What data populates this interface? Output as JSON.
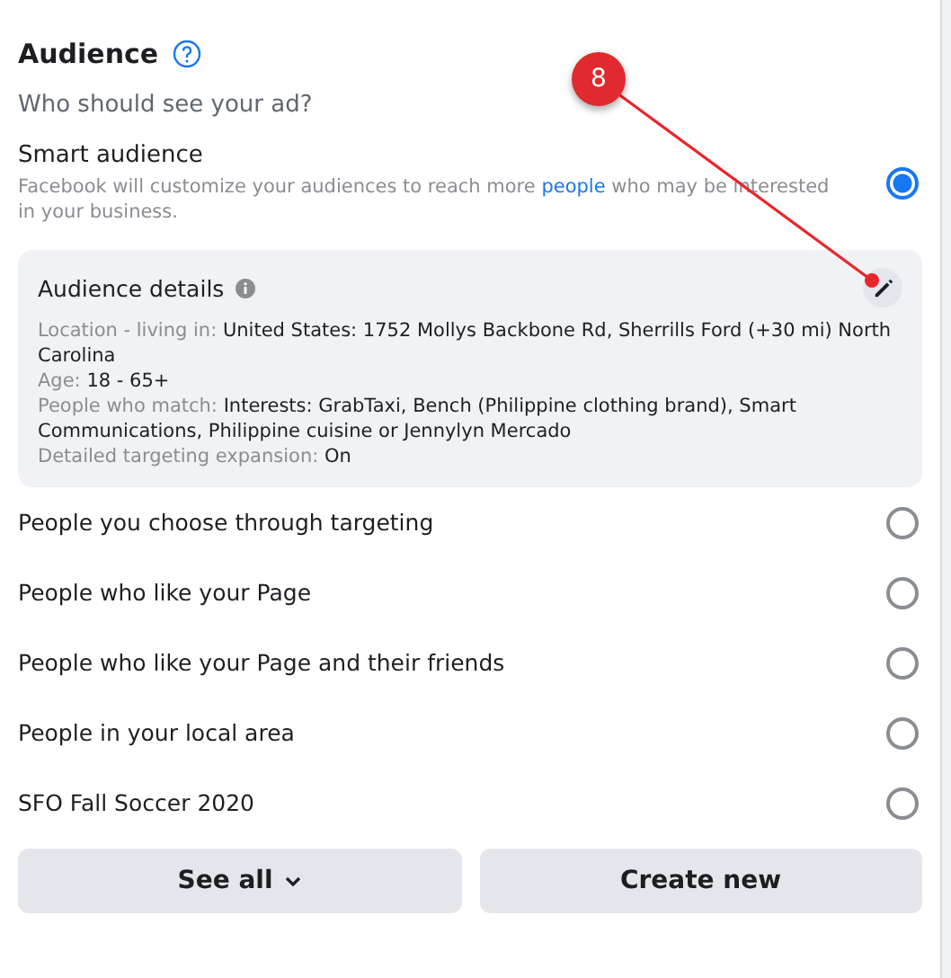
{
  "title": "Audience",
  "subtitle": "Who should see your ad?",
  "smart": {
    "label": "Smart audience",
    "selected": true,
    "desc_before": "Facebook will customize your audiences to reach more ",
    "desc_link": "people",
    "desc_after": " who may be interested in your business."
  },
  "details": {
    "title": "Audience details",
    "lines": [
      {
        "label": "Location - living in:",
        "value": "United States: 1752 Mollys Backbone Rd, Sherrills Ford (+30 mi) North Carolina"
      },
      {
        "label": "Age:",
        "value": "18 - 65+"
      },
      {
        "label": "People who match:",
        "value": "Interests: GrabTaxi, Bench (Philippine clothing brand), Smart Communications, Philippine cuisine or Jennylyn Mercado"
      },
      {
        "label": "Detailed targeting expansion:",
        "value": "On"
      }
    ]
  },
  "options": [
    {
      "label": "People you choose through targeting",
      "selected": false
    },
    {
      "label": "People who like your Page",
      "selected": false
    },
    {
      "label": "People who like your Page and their friends",
      "selected": false
    },
    {
      "label": "People in your local area",
      "selected": false
    },
    {
      "label": "SFO Fall Soccer 2020",
      "selected": false
    }
  ],
  "buttons": [
    {
      "label": "See all",
      "kind": "dropdown"
    },
    {
      "label": "Create new",
      "kind": "plain"
    }
  ],
  "annotation": {
    "number": "8"
  }
}
